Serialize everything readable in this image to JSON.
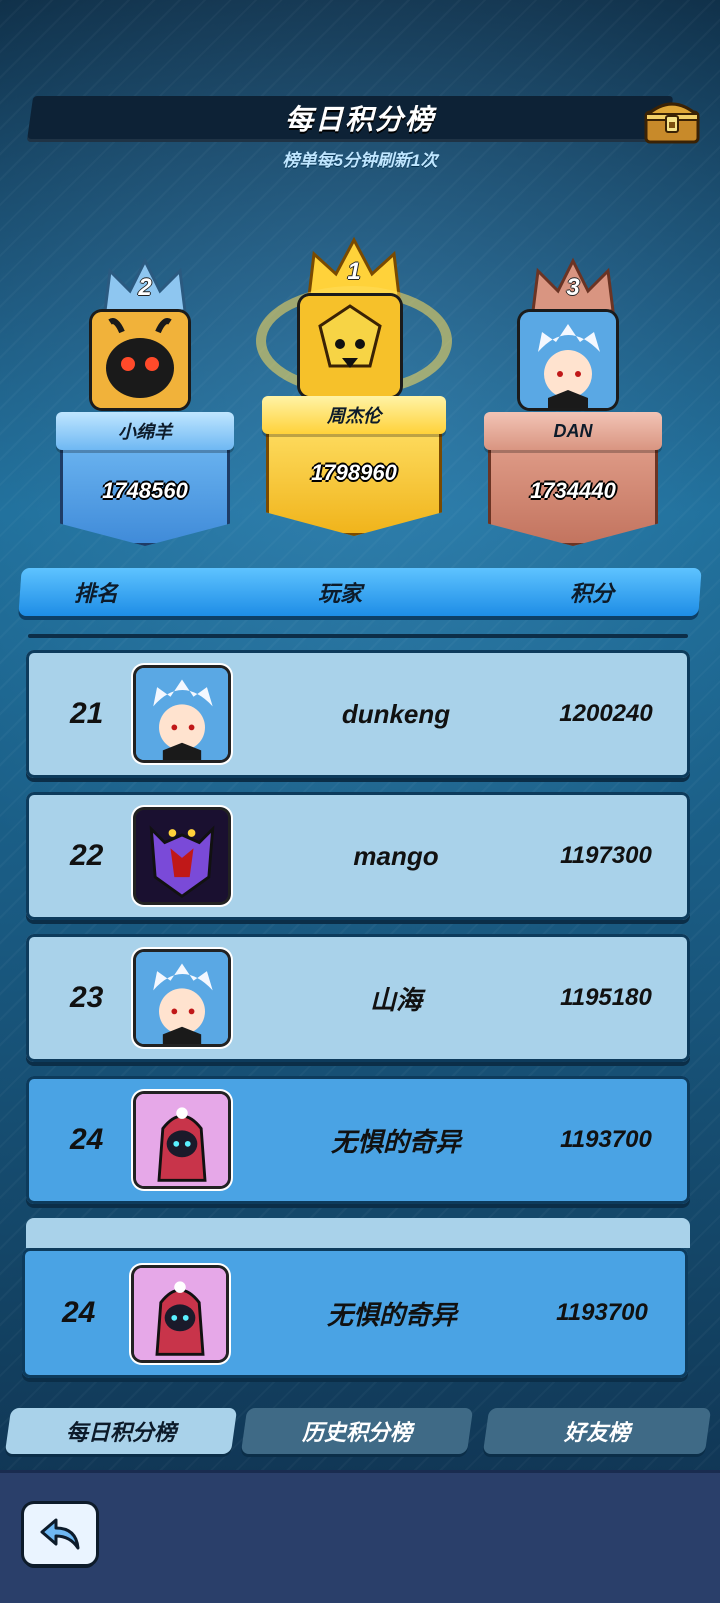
{
  "header": {
    "title": "每日积分榜",
    "subtitle": "榜单每5分钟刷新1次",
    "chest_icon": "treasure-chest-icon"
  },
  "podium": [
    {
      "rank": "1",
      "name": "周杰伦",
      "score": "1798960",
      "avatar": "yellow-spiky-avatar",
      "color": "#f4c62c"
    },
    {
      "rank": "2",
      "name": "小绵羊",
      "score": "1748560",
      "avatar": "black-bug-avatar",
      "color": "#6eb8f2"
    },
    {
      "rank": "3",
      "name": "DAN",
      "score": "1734440",
      "avatar": "white-hair-boy-avatar",
      "color": "#d48a76"
    }
  ],
  "table_header": {
    "rank": "排名",
    "player": "玩家",
    "score": "积分"
  },
  "rows": [
    {
      "rank": "21",
      "name": "dunkeng",
      "score": "1200240",
      "avatar": "white-hair-boy-avatar"
    },
    {
      "rank": "22",
      "name": "mango",
      "score": "1197300",
      "avatar": "purple-demon-avatar"
    },
    {
      "rank": "23",
      "name": "山海",
      "score": "1195180",
      "avatar": "white-hair-boy-avatar"
    },
    {
      "rank": "24",
      "name": "无惧的奇异",
      "score": "1193700",
      "avatar": "hooded-ghost-avatar"
    }
  ],
  "my_row": {
    "rank": "24",
    "name": "无惧的奇异",
    "score": "1193700",
    "avatar": "hooded-ghost-avatar"
  },
  "tabs": [
    {
      "label": "每日积分榜",
      "active": true
    },
    {
      "label": "历史积分榜",
      "active": false
    },
    {
      "label": "好友榜",
      "active": false
    }
  ],
  "back_icon": "back-arrow-icon"
}
